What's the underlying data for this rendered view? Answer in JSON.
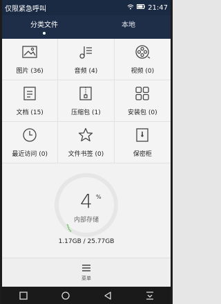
{
  "statusbar": {
    "carrier": "仅限紧急呼叫",
    "battery": "",
    "time": "21:47"
  },
  "tabs": [
    {
      "label": "分类文件",
      "active": true
    },
    {
      "label": "本地",
      "active": false
    }
  ],
  "categories": [
    {
      "label": "图片 (36)",
      "icon": "image-icon"
    },
    {
      "label": "音频 (4)",
      "icon": "music-icon"
    },
    {
      "label": "视频 (0)",
      "icon": "film-reel-icon"
    },
    {
      "label": "文档 (15)",
      "icon": "document-icon"
    },
    {
      "label": "压缩包 (1)",
      "icon": "archive-icon"
    },
    {
      "label": "安装包 (0)",
      "icon": "apps-icon"
    },
    {
      "label": "最近访问 (0)",
      "icon": "clock-icon"
    },
    {
      "label": "文件书签 (0)",
      "icon": "star-icon"
    },
    {
      "label": "保密柜",
      "icon": "safe-icon"
    }
  ],
  "storage": {
    "percent": "4",
    "percent_sign": "%",
    "label": "内部存储",
    "size_text": "1.17GB / 25.77GB"
  },
  "menu": {
    "label": "菜单"
  },
  "colors": {
    "header_bg": "#1e2d48",
    "status_bg": "#1b2a43",
    "accent_arc": "#7bc96f"
  }
}
